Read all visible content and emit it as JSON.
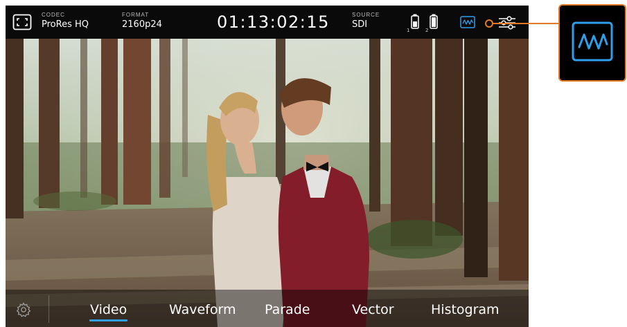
{
  "top_bar": {
    "codec": {
      "label": "CODEC",
      "value": "ProRes HQ"
    },
    "format": {
      "label": "FORMAT",
      "value": "2160p24"
    },
    "timecode": "01:13:02:15",
    "source": {
      "label": "SOURCE",
      "value": "SDI"
    },
    "batteries": [
      {
        "slot": "1",
        "icon": "battery-icon"
      },
      {
        "slot": "2",
        "icon": "battery-full-icon"
      }
    ],
    "scope_icon": "waveform-scope-icon",
    "settings_icon": "sliders-icon",
    "fullscreen_icon": "fullscreen-icon"
  },
  "bottom_bar": {
    "settings_icon": "gear-icon",
    "tabs": [
      {
        "label": "Video",
        "active": true
      },
      {
        "label": "Waveform",
        "active": false
      },
      {
        "label": "Parade",
        "active": false
      },
      {
        "label": "Vector",
        "active": false
      },
      {
        "label": "Histogram",
        "active": false
      }
    ]
  },
  "callout": {
    "icon": "waveform-scope-icon",
    "color": "#e37a27"
  },
  "colors": {
    "accent": "#2f9fea",
    "callout": "#e37a27",
    "bar_bg": "#0a0a0a"
  }
}
